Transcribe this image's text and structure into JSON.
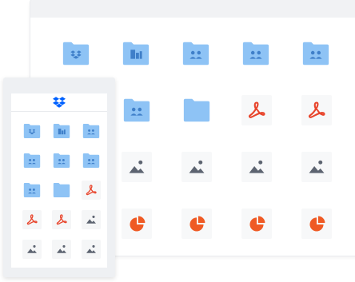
{
  "app": {
    "name": "Dropbox",
    "logo_icon": "dropbox-logo-icon"
  },
  "colors": {
    "folder": "#8ec3f5",
    "folder_dark": "#74b3ef",
    "folder_symbol": "#3f7fc9",
    "pdf": "#e8452c",
    "image": "#5d6471",
    "chart": "#ef5a24",
    "dropbox_blue": "#0061ff"
  },
  "desktop_grid": {
    "rows": [
      [
        "folder-dropbox-icon",
        "folder-building-icon",
        "folder-shared-icon",
        "folder-shared-icon",
        "folder-shared-icon"
      ],
      [
        "folder-shared-icon",
        "folder-icon",
        "pdf-file-icon",
        "pdf-file-icon"
      ],
      [
        "image-file-icon",
        "image-file-icon",
        "image-file-icon",
        "image-file-icon"
      ],
      [
        "chart-file-icon",
        "chart-file-icon",
        "chart-file-icon",
        "chart-file-icon"
      ]
    ]
  },
  "mobile_grid": {
    "rows": [
      [
        "folder-dropbox-icon",
        "folder-building-icon",
        "folder-shared-icon"
      ],
      [
        "folder-shared-icon",
        "folder-shared-icon",
        "folder-shared-icon"
      ],
      [
        "folder-shared-icon",
        "folder-icon",
        "pdf-file-icon"
      ],
      [
        "pdf-file-icon",
        "pdf-file-icon",
        "image-file-icon"
      ],
      [
        "image-file-icon",
        "image-file-icon",
        "image-file-icon"
      ]
    ]
  }
}
